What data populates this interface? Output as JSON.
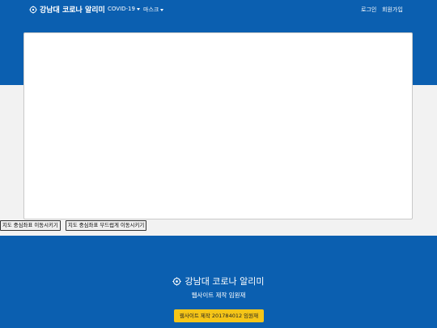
{
  "navbar": {
    "brand": "강남대 코로나 알리미",
    "menu": [
      "COVID-19",
      "마스크"
    ],
    "login": "로그인",
    "signup": "회원가입"
  },
  "map_buttons": {
    "move_center": "지도 중심좌표 이동시키기",
    "pan_center": "지도 중심좌표 부드럽게 이동시키기"
  },
  "footer": {
    "title": "강남대 코로나 알리미",
    "subtitle": "웹사이트 제작 임원재",
    "credit_button": "웹사이트 제작 201784012 임원재"
  },
  "colors": {
    "primary": "#0b5fb0",
    "accent": "#f5c518"
  }
}
